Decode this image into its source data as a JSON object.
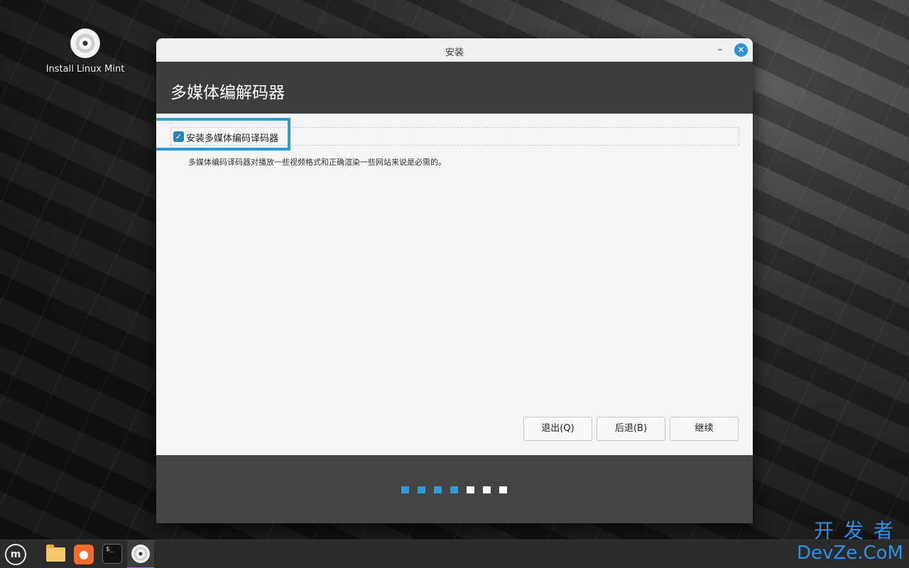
{
  "desktop": {
    "icon_label": "Install Linux Mint"
  },
  "window": {
    "title": "安装",
    "minimize_glyph": "–",
    "close_glyph": "✕",
    "header_title": "多媒体编解码器"
  },
  "content": {
    "checkbox_label": "安装多媒体编码译码器",
    "checkbox_checked": true,
    "description": "多媒体编码译码器对播放一些视频格式和正确渲染一些网站来说是必需的。"
  },
  "buttons": {
    "quit": "退出(Q)",
    "back": "后退(B)",
    "continue": "继续"
  },
  "progress": {
    "total_steps": 7,
    "completed_steps": 4
  },
  "taskbar": {
    "terminal_glyph": "$_"
  },
  "watermark": {
    "line1": "开发者",
    "line2": "DevZe.CoM"
  },
  "colors": {
    "accent": "#2c9bd6"
  }
}
